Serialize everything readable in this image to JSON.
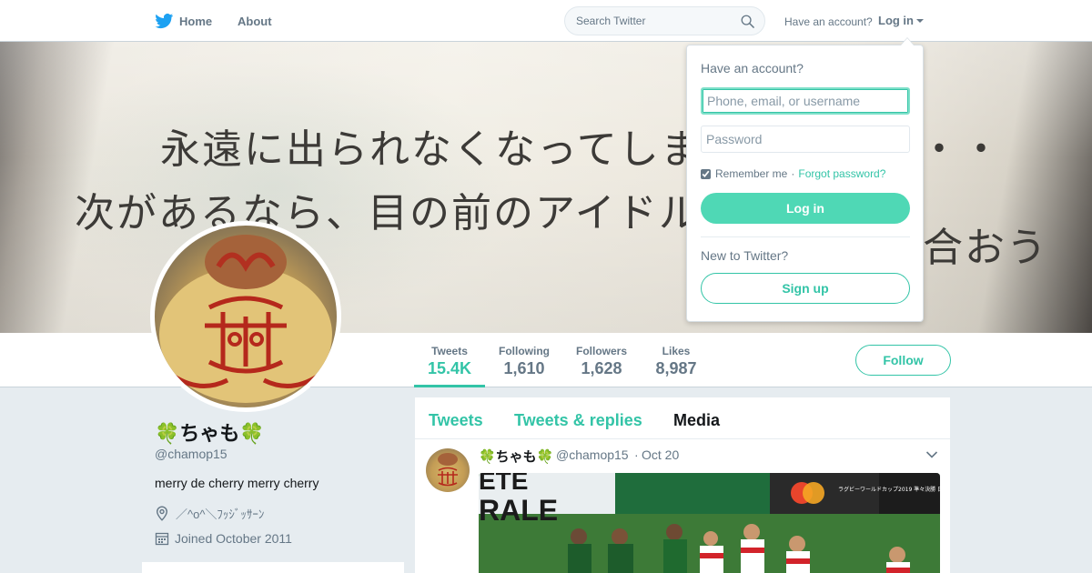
{
  "nav": {
    "home_label": "Home",
    "about_label": "About",
    "search_placeholder": "Search Twitter",
    "have_account": "Have an account?",
    "login_label": "Log in",
    "brand_color": "#1da1f2",
    "logo_icon": "twitter-bird-icon",
    "search_icon": "magnifier-icon"
  },
  "banner": {
    "line1": "永遠に出られなくなってしまっ",
    "line1_tail": "・・",
    "line2": "次があるなら、目の前のアイドルとし",
    "line2_tail": "合おう"
  },
  "profile": {
    "name": "🍀ちゃも🍀",
    "handle": "@chamop15",
    "bio": "merry de cherry merry cherry",
    "location": "／^o^＼ﾌｯｼﾞｯｻｰﾝ",
    "joined": "Joined October 2011",
    "accent_color": "#33c4a7"
  },
  "stats": [
    {
      "label": "Tweets",
      "value": "15.4K"
    },
    {
      "label": "Following",
      "value": "1,610"
    },
    {
      "label": "Followers",
      "value": "1,628"
    },
    {
      "label": "Likes",
      "value": "8,987"
    }
  ],
  "follow_label": "Follow",
  "timeline": {
    "tabs": [
      "Tweets",
      "Tweets & replies",
      "Media"
    ],
    "selected_tab": "Media",
    "tweet": {
      "name": "🍀ちゃも🍀",
      "handle": "@chamop15",
      "dot": "·",
      "date": "Oct 20",
      "media_text_1": "ETE",
      "media_text_2": "RALE",
      "media_overlay": "ラグビーワールドカップ2019 準々決勝 日本 vs. 南アフリカ LIVE"
    }
  },
  "login_dropdown": {
    "title": "Have an account?",
    "username_placeholder": "Phone, email, or username",
    "password_placeholder": "Password",
    "remember_label": "Remember me",
    "separator": "·",
    "forgot_label": "Forgot password?",
    "login_button": "Log in",
    "new_label": "New to Twitter?",
    "signup_button": "Sign up"
  }
}
